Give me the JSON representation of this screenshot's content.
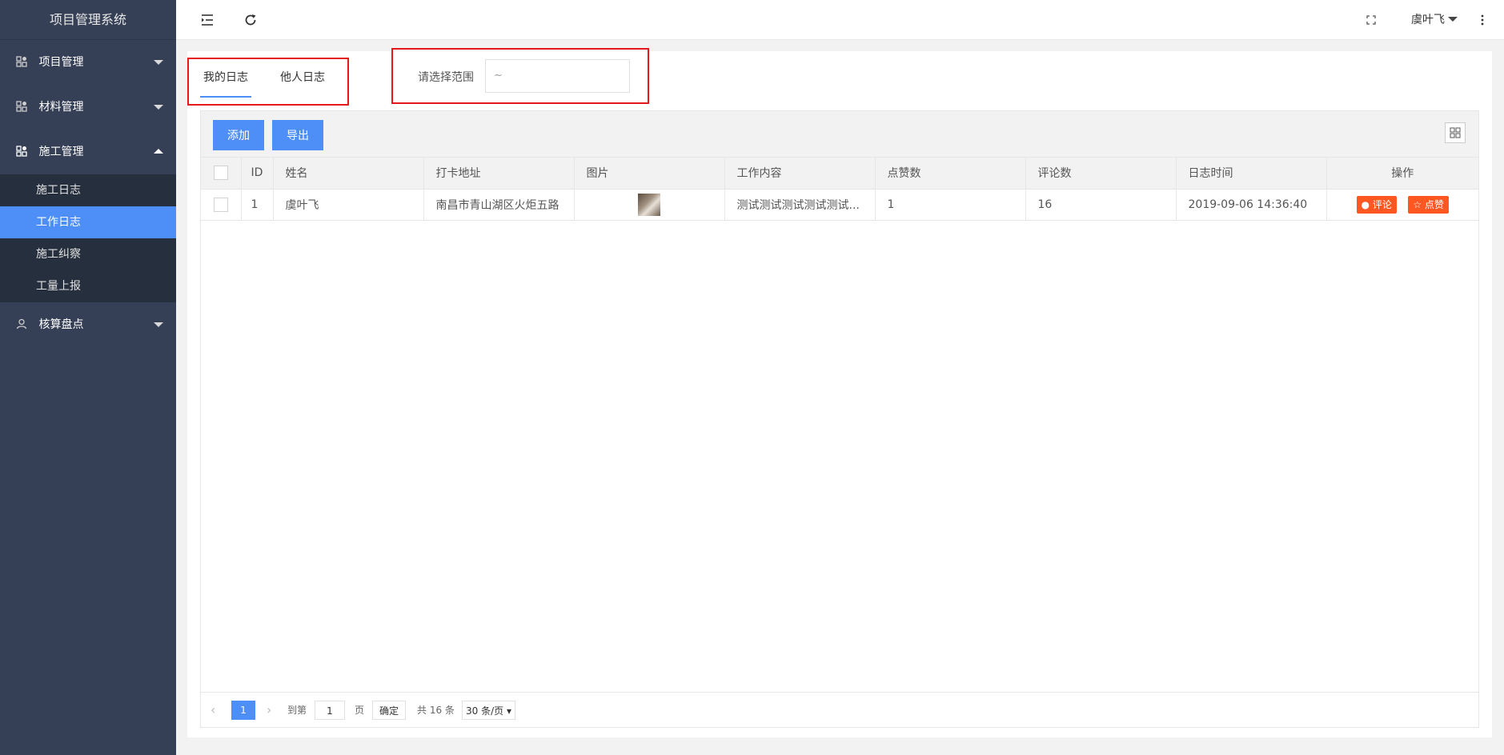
{
  "app_title": "项目管理系统",
  "sidebar": {
    "menus": [
      {
        "label": "项目管理"
      },
      {
        "label": "材料管理"
      },
      {
        "label": "施工管理"
      },
      {
        "label": "核算盘点"
      }
    ],
    "submenu": [
      {
        "label": "施工日志"
      },
      {
        "label": "工作日志"
      },
      {
        "label": "施工纠察"
      },
      {
        "label": "工量上报"
      }
    ]
  },
  "topbar": {
    "user": "虞叶飞"
  },
  "tabs": [
    {
      "label": "我的日志"
    },
    {
      "label": "他人日志"
    }
  ],
  "range": {
    "label": "请选择范围",
    "value": "~"
  },
  "toolbar": {
    "add": "添加",
    "export": "导出"
  },
  "table": {
    "headers": [
      "ID",
      "姓名",
      "打卡地址",
      "图片",
      "工作内容",
      "点赞数",
      "评论数",
      "日志时间",
      "操作"
    ],
    "rows": [
      {
        "id": "1",
        "name": "虞叶飞",
        "address": "南昌市青山湖区火炬五路",
        "content": "测试测试测试测试测试...",
        "likes": "1",
        "comments": "16",
        "time": "2019-09-06 14:36:40"
      }
    ],
    "actions": {
      "comment": "评论",
      "like": "点赞"
    }
  },
  "pager": {
    "current": "1",
    "goto": "到第",
    "page_value": "1",
    "page_unit": "页",
    "confirm": "确定",
    "total": "共 16 条",
    "per_page": "30 条/页"
  },
  "colors": {
    "sidebar": "#353f55",
    "submenu": "#262f3e",
    "primary": "#4d8ff7",
    "action": "#ff5722",
    "highlight": "#e5191c"
  },
  "icons": [
    "menu-fold-icon",
    "refresh-icon",
    "fullscreen-icon",
    "more-icon",
    "columns-icon",
    "comment-icon",
    "star-icon"
  ]
}
